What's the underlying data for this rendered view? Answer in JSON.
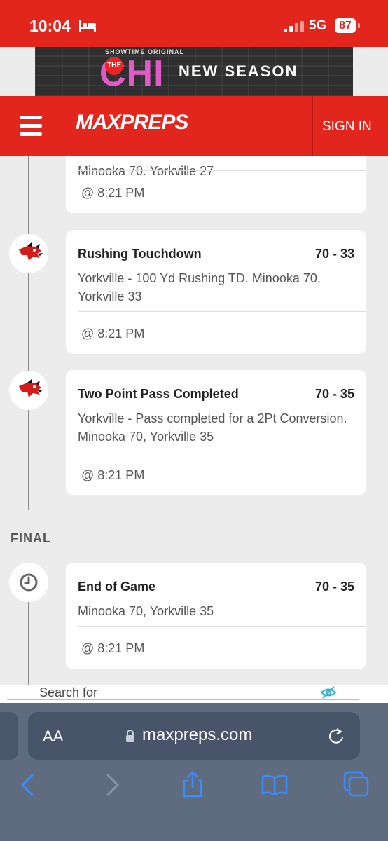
{
  "status": {
    "time": "10:04",
    "network": "5G",
    "battery": "87"
  },
  "ad": {
    "top_line": "SHOWTIME ORIGINAL",
    "the": "THE",
    "show": "CHI",
    "tagline": "NEW SEASON"
  },
  "nav": {
    "logo": "MAXPREPS",
    "sign_in": "SIGN IN"
  },
  "partial_card": {
    "desc": "Minooka 70, Yorkville 27",
    "time": "@ 8:21 PM"
  },
  "events": [
    {
      "title": "Rushing Touchdown",
      "score": "70 - 33",
      "desc": "Yorkville - 100 Yd Rushing TD. Minooka 70, Yorkville 33",
      "time": "@ 8:21 PM"
    },
    {
      "title": "Two Point Pass Completed",
      "score": "70 - 35",
      "desc": "Yorkville - Pass completed for a 2Pt Conversion. Minooka 70, Yorkville 35",
      "time": "@ 8:21 PM"
    }
  ],
  "final_section": {
    "label": "FINAL",
    "event": {
      "title": "End of Game",
      "score": "70 - 35",
      "desc": "Minooka 70, Yorkville 35",
      "time": "@ 8:21 PM"
    }
  },
  "search_strip": {
    "label": "Search for"
  },
  "browser": {
    "text_size": "AA",
    "url": "maxpreps.com"
  },
  "colors": {
    "brand_red": "#e3261d",
    "browser_bar": "#5f6c80",
    "ios_blue": "#3b8cff"
  }
}
